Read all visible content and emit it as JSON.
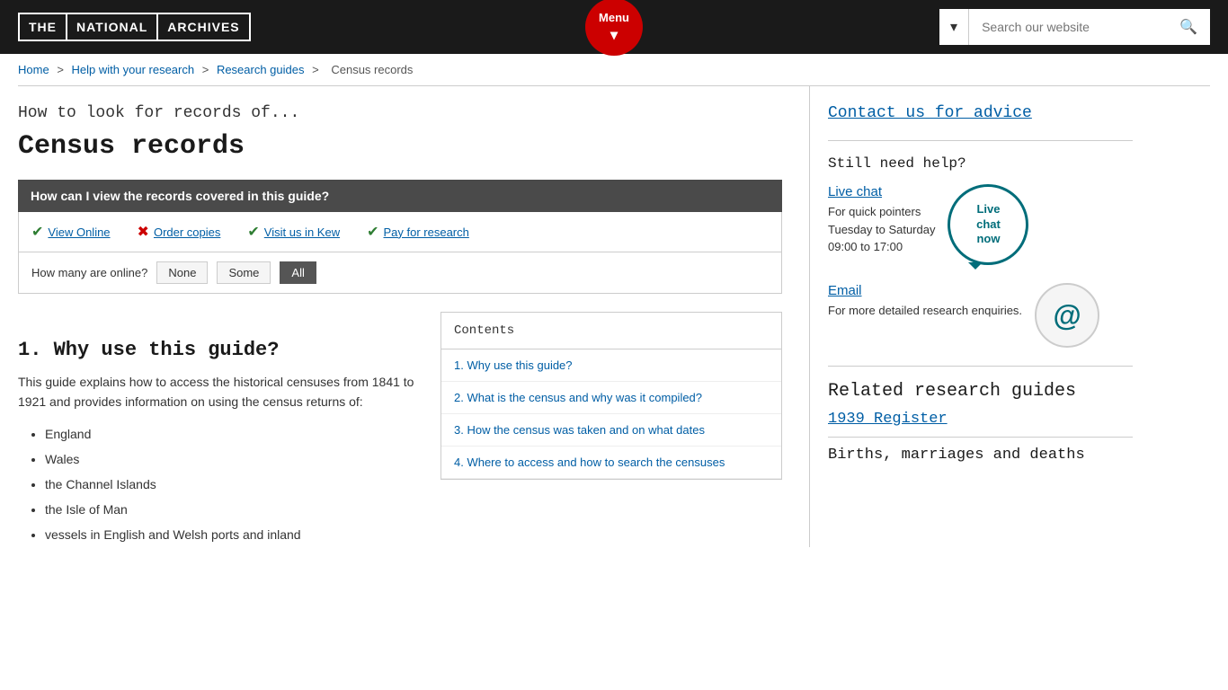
{
  "header": {
    "logo": {
      "part1": "THE",
      "part2": "NATIONAL",
      "part3": "ARCHIVES"
    },
    "menu_label": "Menu",
    "search_placeholder": "Search our website"
  },
  "breadcrumb": {
    "items": [
      {
        "label": "Home",
        "href": "#"
      },
      {
        "label": "Help with your research",
        "href": "#"
      },
      {
        "label": "Research guides",
        "href": "#"
      },
      {
        "label": "Census records"
      }
    ]
  },
  "main": {
    "subtitle": "How to look for records of...",
    "title": "Census records",
    "access_bar": {
      "question": "How can I view the records covered in this guide?"
    },
    "access_options": [
      {
        "label": "View Online",
        "type": "green_check"
      },
      {
        "label": "Order copies",
        "type": "red_x"
      },
      {
        "label": "Visit us in Kew",
        "type": "green_check"
      },
      {
        "label": "Pay for research",
        "type": "green_check"
      }
    ],
    "filter": {
      "label": "How many are online?",
      "options": [
        "None",
        "Some",
        "All"
      ],
      "active": "All"
    },
    "section1": {
      "heading": "1.  Why use this guide?",
      "text": "This guide explains how to access the historical censuses from 1841 to 1921 and provides information on using the census returns of:",
      "list": [
        "England",
        "Wales",
        "the Channel Islands",
        "the Isle of Man",
        "vessels in English and Welsh ports and inland"
      ]
    },
    "contents": {
      "title": "Contents",
      "items": [
        {
          "label": "1. Why use this guide?",
          "href": "#"
        },
        {
          "label": "2. What is the census and why was it compiled?",
          "href": "#"
        },
        {
          "label": "3. How the census was taken and on what dates",
          "href": "#"
        },
        {
          "label": "4. Where to access and how to search the censuses",
          "href": "#"
        }
      ]
    }
  },
  "sidebar": {
    "contact_link": "Contact us for advice",
    "still_need_help": "Still need help?",
    "live_chat": {
      "label": "Live chat",
      "bubble_text": "Live\nchat\nnow",
      "description_line1": "For quick pointers",
      "description_line2": "Tuesday to Saturday",
      "description_line3": "09:00 to 17:00"
    },
    "email": {
      "label": "Email",
      "symbol": "@",
      "description": "For more detailed research enquiries."
    },
    "related_guides": {
      "title": "Related research guides",
      "items": [
        {
          "label": "1939 Register",
          "href": "#"
        },
        {
          "label": "Births, marriages and deaths",
          "partial": true
        }
      ]
    }
  }
}
